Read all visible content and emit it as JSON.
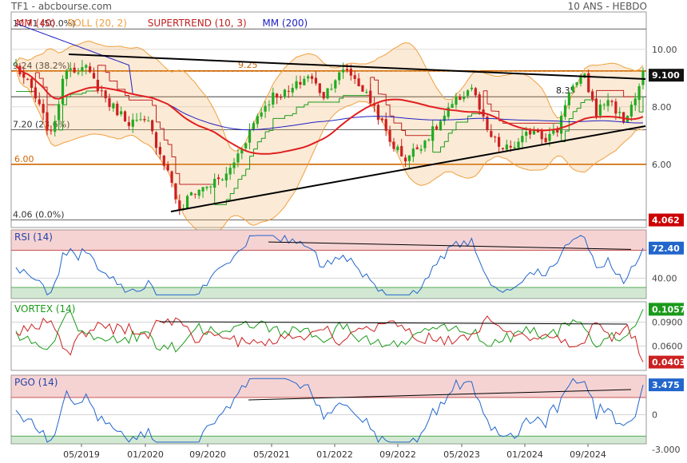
{
  "header": {
    "source": "TF1 - abcbourse.com",
    "period": "10 ANS - HEBDO"
  },
  "colors": {
    "mm40": "#e02020",
    "boll": "#f0a040",
    "supertrend_up": "#1a9a1a",
    "supertrend_dn": "#c02020",
    "mm200": "#2020c0",
    "up": "#22aa22",
    "down": "#cc2020",
    "fib": "#333333",
    "orange": "#cc6600"
  },
  "chart_data": [
    {
      "type": "candlestick",
      "legend": [
        {
          "label": "MM (40)",
          "color": "#e02020"
        },
        {
          "label": "BOLL (20, 2)",
          "color": "#f0a040"
        },
        {
          "label": "SUPERTREND (10, 3)",
          "color": "#c02020"
        },
        {
          "label": "MM (200)",
          "color": "#2020c0"
        }
      ],
      "x": [
        "05/2019",
        "01/2020",
        "09/2020",
        "05/2021",
        "01/2022",
        "09/2022",
        "05/2023",
        "01/2024",
        "09/2024"
      ],
      "ylim": [
        3.8,
        11.3
      ],
      "yticks": [
        6.0,
        8.0,
        10.0
      ],
      "ytick_labels": [
        "6.00",
        "8.00",
        "10.00"
      ],
      "fib_levels": [
        {
          "value": 10.71,
          "label": "10.71  (50.0%)"
        },
        {
          "value": 9.24,
          "label": "9.24  (38.2%)"
        },
        {
          "value": 7.2,
          "label": "7.20  (23.6%)"
        },
        {
          "value": 4.06,
          "label": "4.06  (0.0%)"
        }
      ],
      "levels": [
        {
          "value": 9.25,
          "label": "9.25"
        },
        {
          "value": 8.35,
          "label": "8.35"
        },
        {
          "value": 6.0,
          "label": "6.00"
        }
      ],
      "badges": [
        {
          "value": 9.1,
          "label": "9.100",
          "color": "#111111"
        },
        {
          "value": 4.062,
          "label": "4.062",
          "color": "#cc0000"
        }
      ],
      "close_keypoints": [
        [
          0,
          9.4
        ],
        [
          4,
          8.6
        ],
        [
          9,
          7.0
        ],
        [
          13,
          9.4
        ],
        [
          18,
          9.3
        ],
        [
          24,
          8.1
        ],
        [
          29,
          7.5
        ],
        [
          34,
          7.4
        ],
        [
          40,
          5.4
        ],
        [
          42,
          4.3
        ],
        [
          45,
          5.0
        ],
        [
          50,
          5.3
        ],
        [
          54,
          5.6
        ],
        [
          58,
          6.6
        ],
        [
          62,
          7.7
        ],
        [
          66,
          8.4
        ],
        [
          70,
          8.5
        ],
        [
          75,
          9.1
        ],
        [
          79,
          8.4
        ],
        [
          82,
          9.0
        ],
        [
          85,
          9.3
        ],
        [
          88,
          8.8
        ],
        [
          92,
          8.0
        ],
        [
          96,
          6.8
        ],
        [
          100,
          6.2
        ],
        [
          104,
          6.7
        ],
        [
          108,
          7.3
        ],
        [
          113,
          8.2
        ],
        [
          117,
          8.7
        ],
        [
          121,
          7.1
        ],
        [
          125,
          6.5
        ],
        [
          129,
          6.7
        ],
        [
          133,
          7.3
        ],
        [
          136,
          6.9
        ],
        [
          139,
          7.2
        ],
        [
          142,
          8.6
        ],
        [
          146,
          9.0
        ],
        [
          149,
          7.8
        ],
        [
          152,
          8.3
        ],
        [
          156,
          7.5
        ],
        [
          159,
          8.3
        ],
        [
          161,
          9.1
        ]
      ]
    },
    {
      "type": "line",
      "title": "RSI (14)",
      "ylim": [
        18,
        92
      ],
      "yticks": [
        40
      ],
      "ytick_labels": [
        "40.00"
      ],
      "zones": {
        "upper": 70,
        "lower": 30
      },
      "last": {
        "value": 72.4,
        "label": "72.40",
        "color": "#2266cc"
      }
    },
    {
      "type": "line",
      "title": "VORTEX (14)",
      "ylim": [
        0.03,
        0.115
      ],
      "yticks": [
        0.09,
        0.06
      ],
      "ytick_labels": [
        "0.0900",
        "0.0600"
      ],
      "series": [
        {
          "color": "#1a9a1a",
          "last": {
            "value": 0.1057,
            "label": "0.1057"
          }
        },
        {
          "color": "#cc2020",
          "last": {
            "value": 0.0403,
            "label": "0.0403"
          }
        }
      ]
    },
    {
      "type": "line",
      "title": "PGO (14)",
      "ylim": [
        -3.4,
        4.6
      ],
      "yticks": [
        0
      ],
      "ytick_labels": [
        "0"
      ],
      "bottom_label": "-3.000",
      "zones": {
        "upper": 2,
        "lower": -2.5
      },
      "last": {
        "value": 3.475,
        "label": "3.475",
        "color": "#2266cc"
      }
    }
  ]
}
